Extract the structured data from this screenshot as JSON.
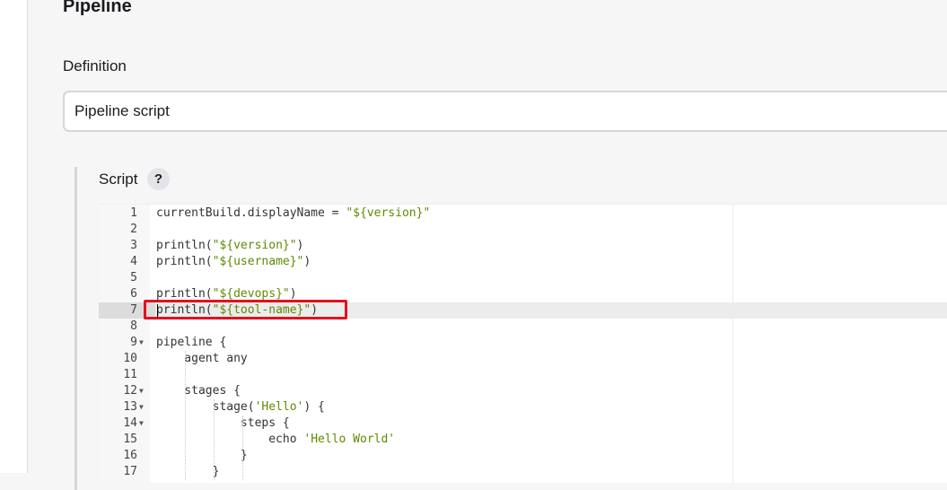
{
  "section": {
    "title": "Pipeline"
  },
  "definition": {
    "label": "Definition",
    "value": "Pipeline script"
  },
  "script": {
    "label": "Script",
    "help_icon": "?",
    "lines": [
      {
        "n": "1",
        "fold": false,
        "segments": [
          {
            "t": "currentBuild.displayName = "
          },
          {
            "t": "\"${version}\"",
            "s": true
          }
        ]
      },
      {
        "n": "2",
        "fold": false,
        "segments": []
      },
      {
        "n": "3",
        "fold": false,
        "segments": [
          {
            "t": "println("
          },
          {
            "t": "\"${version}\"",
            "s": true
          },
          {
            "t": ")"
          }
        ]
      },
      {
        "n": "4",
        "fold": false,
        "segments": [
          {
            "t": "println("
          },
          {
            "t": "\"${username}\"",
            "s": true
          },
          {
            "t": ")"
          }
        ]
      },
      {
        "n": "5",
        "fold": false,
        "segments": []
      },
      {
        "n": "6",
        "fold": false,
        "segments": [
          {
            "t": "println("
          },
          {
            "t": "\"${devops}\"",
            "s": true
          },
          {
            "t": ")"
          }
        ]
      },
      {
        "n": "7",
        "fold": false,
        "active": true,
        "segments": [
          {
            "t": "println("
          },
          {
            "t": "\"${tool-name}\"",
            "s": true
          },
          {
            "t": ")"
          }
        ]
      },
      {
        "n": "8",
        "fold": false,
        "segments": []
      },
      {
        "n": "9",
        "fold": true,
        "segments": [
          {
            "t": "pipeline {"
          }
        ]
      },
      {
        "n": "10",
        "fold": false,
        "segments": [
          {
            "t": "    agent any"
          }
        ]
      },
      {
        "n": "11",
        "fold": false,
        "segments": []
      },
      {
        "n": "12",
        "fold": true,
        "segments": [
          {
            "t": "    stages {"
          }
        ]
      },
      {
        "n": "13",
        "fold": true,
        "segments": [
          {
            "t": "        stage("
          },
          {
            "t": "'Hello'",
            "s": true
          },
          {
            "t": ") {"
          }
        ]
      },
      {
        "n": "14",
        "fold": true,
        "segments": [
          {
            "t": "            steps {"
          }
        ]
      },
      {
        "n": "15",
        "fold": false,
        "segments": [
          {
            "t": "                echo "
          },
          {
            "t": "'Hello World'",
            "s": true
          }
        ]
      },
      {
        "n": "16",
        "fold": false,
        "segments": [
          {
            "t": "            }"
          }
        ]
      },
      {
        "n": "17",
        "fold": false,
        "segments": [
          {
            "t": "        }"
          }
        ]
      }
    ]
  },
  "colors": {
    "string": "#5f8a00",
    "highlight_box": "#e5101c",
    "background": "#f6f6f7"
  }
}
